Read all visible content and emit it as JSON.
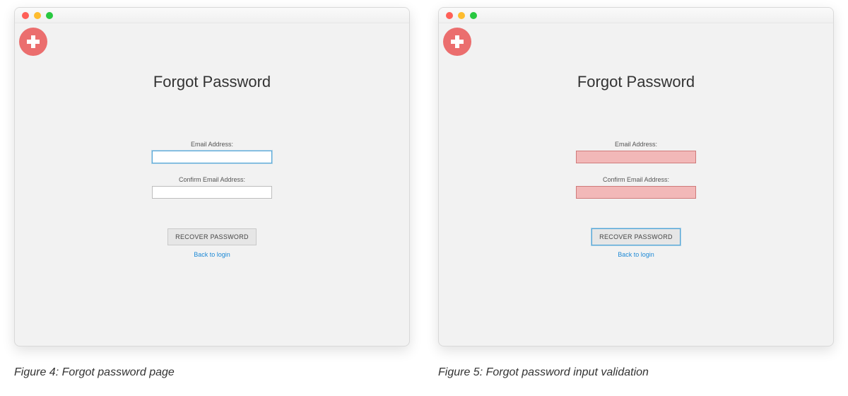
{
  "left": {
    "title": "Forgot Password",
    "email_label": "Email Address:",
    "confirm_label": "Confirm Email Address:",
    "email_value": "",
    "confirm_value": "",
    "recover_label": "RECOVER PASSWORD",
    "back_label": "Back to login",
    "caption": "Figure 4: Forgot password page"
  },
  "right": {
    "title": "Forgot Password",
    "email_label": "Email Address:",
    "confirm_label": "Confirm Email Address:",
    "email_value": "",
    "confirm_value": "",
    "recover_label": "RECOVER PASSWORD",
    "back_label": "Back to login",
    "caption": "Figure 5: Forgot password input validation"
  }
}
